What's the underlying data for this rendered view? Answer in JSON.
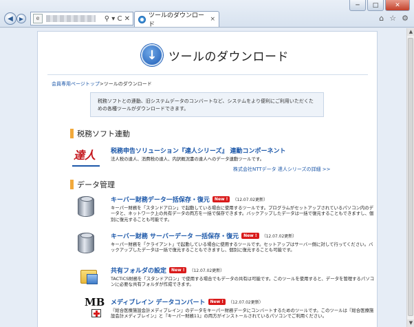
{
  "browser": {
    "tab_title": "ツールのダウンロード",
    "tab_close": "×",
    "address_icons": "⚲ ▾ C ✕",
    "address_page_icon": "e",
    "window_controls": [
      "─",
      "□",
      "✕"
    ],
    "nav_back": "◀",
    "nav_forward": "▶",
    "toolbar_icons": [
      "⌂",
      "☆",
      "⚙"
    ]
  },
  "page": {
    "title": "ツールのダウンロード",
    "title_icon_glyph": "↓",
    "breadcrumb_link": "会員専用ページトップ",
    "breadcrumb_sep": ">",
    "breadcrumb_current": "ツールのダウンロード",
    "intro": "税務ソフトとの連動、旧システムデータのコンバートなど、システムをより便利にご利用いただくための各種ツールがダウンロードできます。"
  },
  "sections": {
    "tax": {
      "heading": "税務ソフト連動",
      "item": {
        "icon_text": "達人",
        "title": "税務申告ソリューション『達人シリーズ』 連動コンポーネント",
        "desc": "法人税の達人、消費税の達人、内訳概況書の達人へのデータ連動ツールです。",
        "more": "株式会社NTTデータ 達人シリーズの詳細 >>"
      }
    },
    "data": {
      "heading": "データ管理",
      "items": [
        {
          "title": "キーバー財務データ一括保存・復元",
          "new": "New !",
          "updated": "（12.07.02更新）",
          "desc": "キーパー財務を「スタンドアロン」で起動している場合に使用するツールです。プログラムがセットアップされているパソコン内のデータと、ネットワーク上の共有データの両方を一括で保存できます。バックアップしたデータは一括で復元することもできますし、個別に復元することも可能です。"
        },
        {
          "title": "キーバー財務 サーバーデータ 一括保存・復元",
          "new": "New !",
          "updated": "（12.07.02更新）",
          "desc": "キーパー財務を「クライアント」で起動している場合に使用するツールです。セットアップはサーバー側に対して行ってください。バックアップしたデータは一括で復元することもできますし、個別に復元することも可能です。"
        },
        {
          "title": "共有フォルダの設定",
          "new": "New !",
          "updated": "（12.07.02更新）",
          "desc": "TACTiCS財務を「スタンドアロン」で使用する場合でもデータの共有は可能です。このツールを使用すると、データを管理するパソコンに必要な共有フォルダが作成できます。"
        },
        {
          "icon_text": "MB",
          "title": "メディブレイン データコンバート",
          "new": "New !",
          "updated": "（12.07.02更新）",
          "desc": "『総合医療施設会計メディブレイン』のデータをキーパー財務データにコンバートするためのツールです。このツールは『総合医療施設会計メディブレイン』と『キーパー財務11』の両方がインストールされているパソコンでご利用ください。"
        }
      ]
    }
  }
}
